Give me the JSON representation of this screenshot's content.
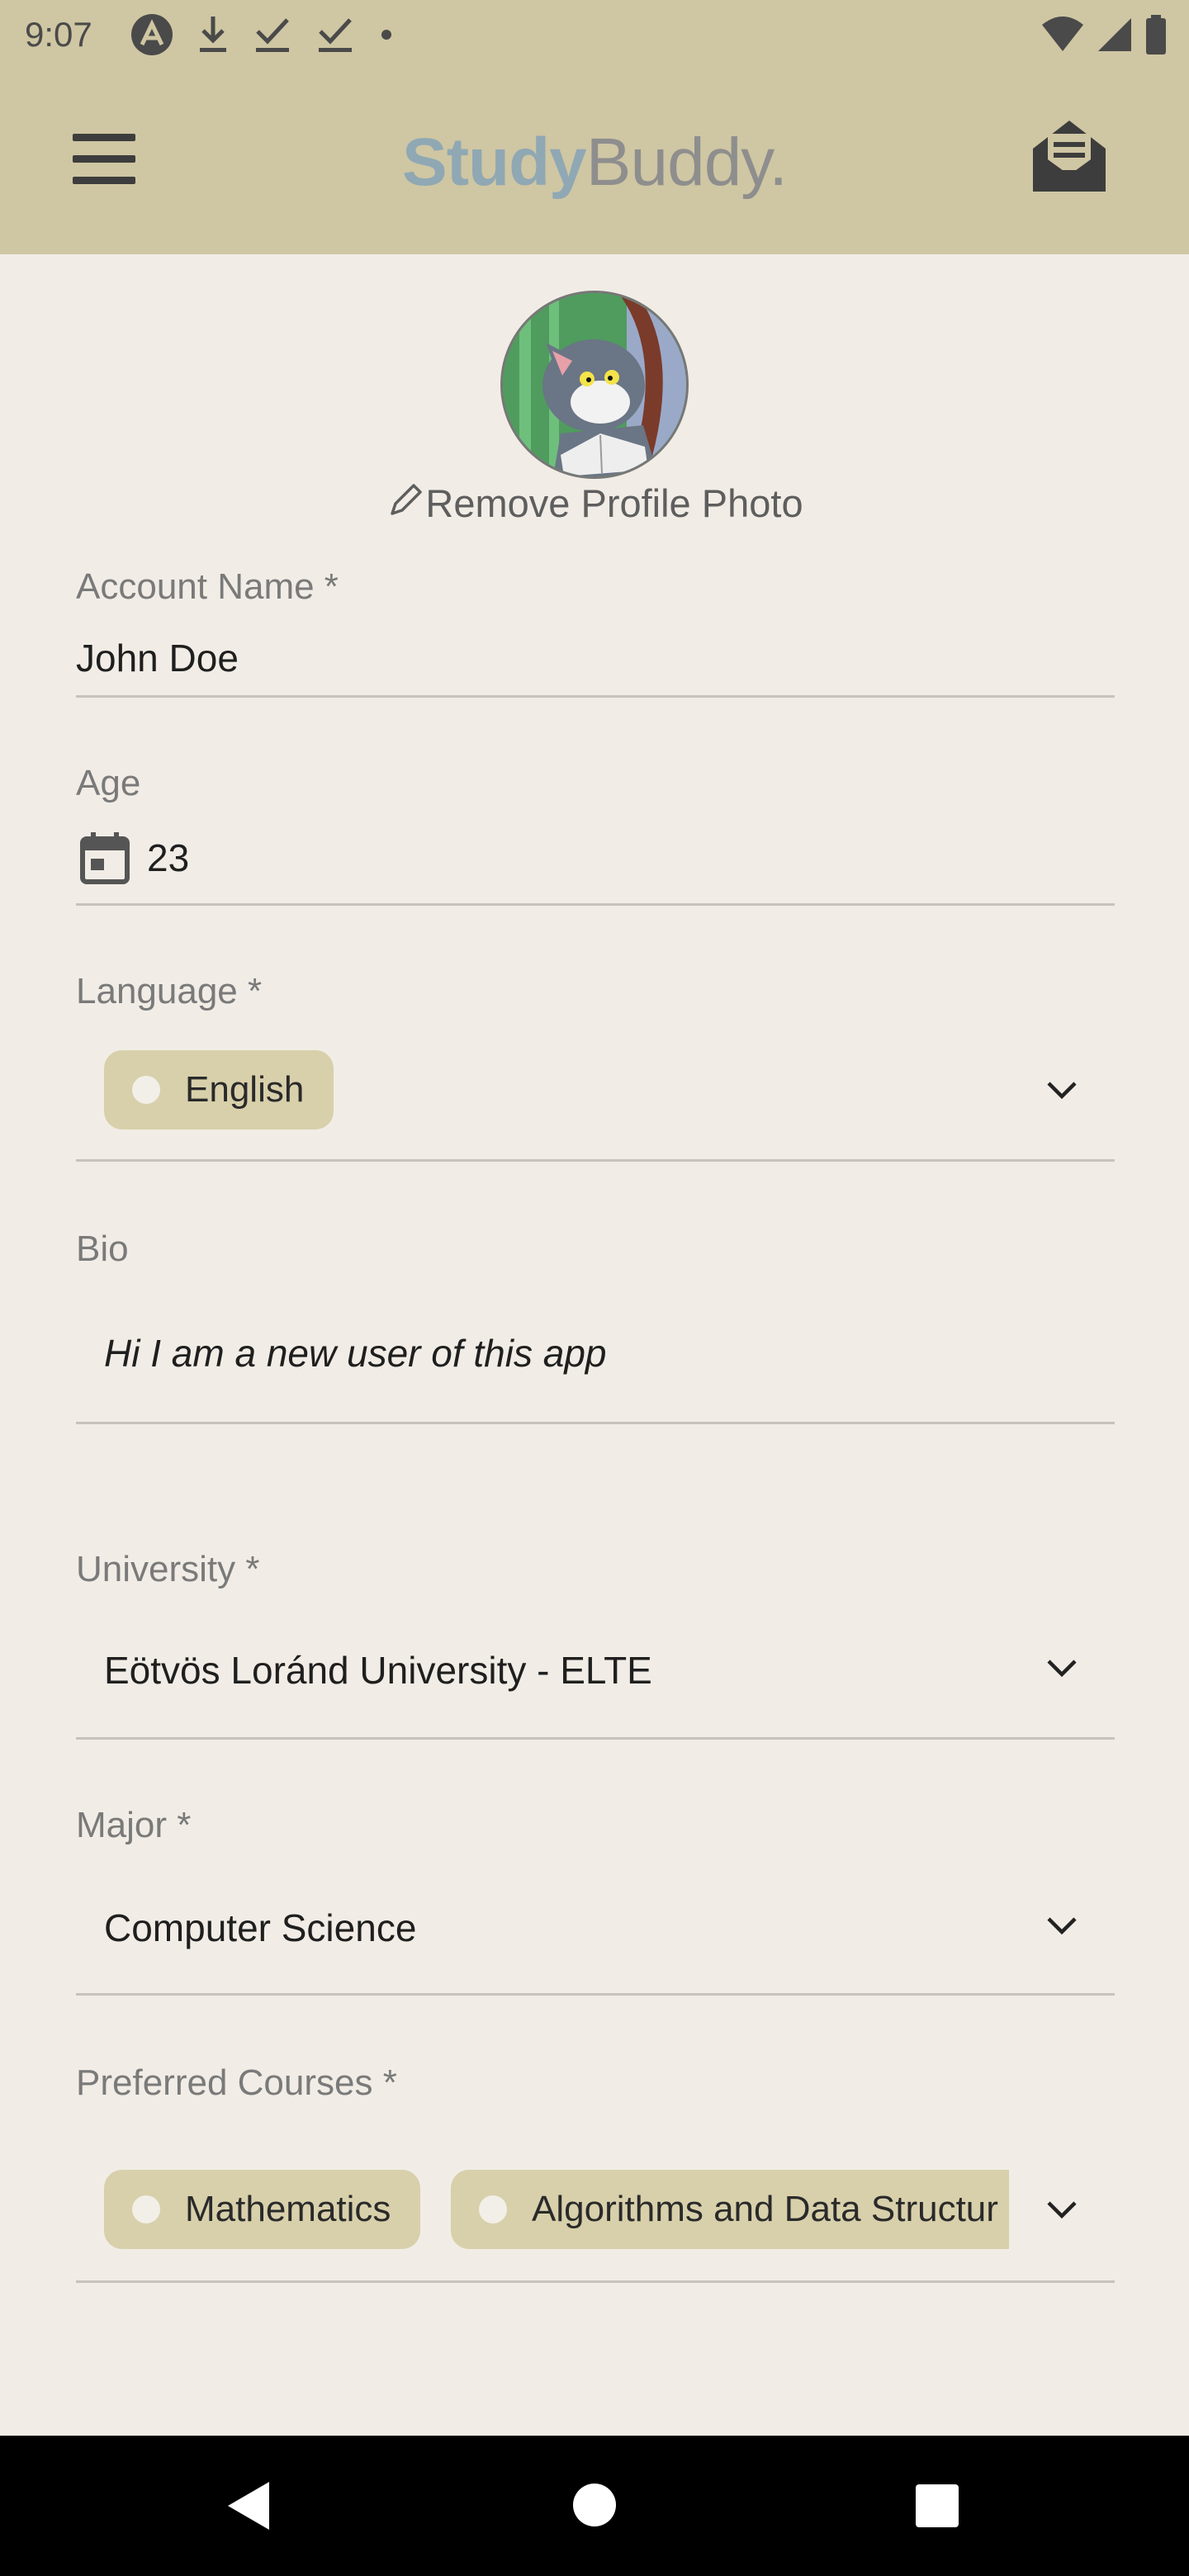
{
  "status_bar": {
    "time": "9:07",
    "icons": [
      "app-notification-icon",
      "download-icon",
      "check-icon",
      "check-icon",
      "dot-icon",
      "wifi-icon",
      "signal-icon",
      "battery-icon"
    ]
  },
  "app_bar": {
    "logo_part1": "Study",
    "logo_part2": "Buddy."
  },
  "profile": {
    "remove_photo_label": "Remove Profile Photo"
  },
  "form": {
    "account_name": {
      "label": "Account Name *",
      "value": "John Doe"
    },
    "age": {
      "label": "Age",
      "value": "23"
    },
    "language": {
      "label": "Language *",
      "chips": [
        "English"
      ]
    },
    "bio": {
      "label": "Bio",
      "value": "Hi I am a new user of this app"
    },
    "university": {
      "label": "University *",
      "value": "Eötvös Loránd University - ELTE"
    },
    "major": {
      "label": "Major *",
      "value": "Computer Science"
    },
    "preferred_courses": {
      "label": "Preferred Courses *",
      "chips": [
        "Mathematics",
        "Algorithms and Data Structur"
      ]
    }
  },
  "colors": {
    "app_bar": "#cfc6a3",
    "background": "#f1ede6",
    "chip": "#d8d0ab",
    "logo_study": "#8fa8b4",
    "logo_buddy": "#8e8e8e"
  }
}
